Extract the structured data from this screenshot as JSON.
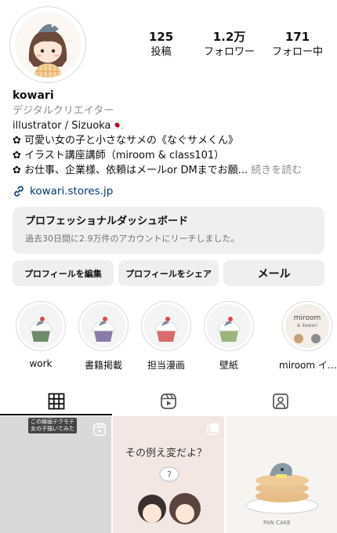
{
  "profile": {
    "username": "kowari",
    "category": "デジタルクリエイター",
    "bio_lines": [
      "illustrator / Sizuoka🇯🇵",
      "✿ 可愛い女の子と小さなサメの《なぐサメくん》",
      "✿ イラスト講座講師（miroom & class101）"
    ],
    "bio_truncated": "✿ お仕事、企業様、依頼はメールor DMまでお願...",
    "more_label": "続きを読む",
    "link": "kowari.stores.jp"
  },
  "stats": [
    {
      "value": "125",
      "label": "投稿"
    },
    {
      "value": "1.2万",
      "label": "フォロワー"
    },
    {
      "value": "171",
      "label": "フォロー中"
    }
  ],
  "dashboard": {
    "title": "プロフェッショナルダッシュボード",
    "subtitle": "過去30日間に2.9万件のアカウントにリーチしました。"
  },
  "buttons": {
    "edit": "プロフィールを編集",
    "share": "プロフィールをシェア",
    "mail": "メール"
  },
  "highlights": [
    {
      "label": "work"
    },
    {
      "label": "書籍掲載"
    },
    {
      "label": "担当漫画"
    },
    {
      "label": "壁紙"
    },
    {
      "label": "miroom イ…",
      "cover_text": "miroom & kowari"
    }
  ],
  "tabs": [
    {
      "icon": "grid-icon",
      "active": true
    },
    {
      "icon": "reels-icon",
      "active": false
    },
    {
      "icon": "tagged-icon",
      "active": false
    }
  ],
  "posts": [
    {
      "caption": "この線画テクモテ\n女の子描いてみた",
      "type": "reel"
    },
    {
      "text": "その例え変だよ？",
      "type": "carousel"
    },
    {
      "text": "PAN CAKE",
      "type": "image"
    }
  ],
  "colors": {
    "link": "#00376b",
    "muted": "#8e8e8e",
    "button_bg": "#efefef"
  }
}
